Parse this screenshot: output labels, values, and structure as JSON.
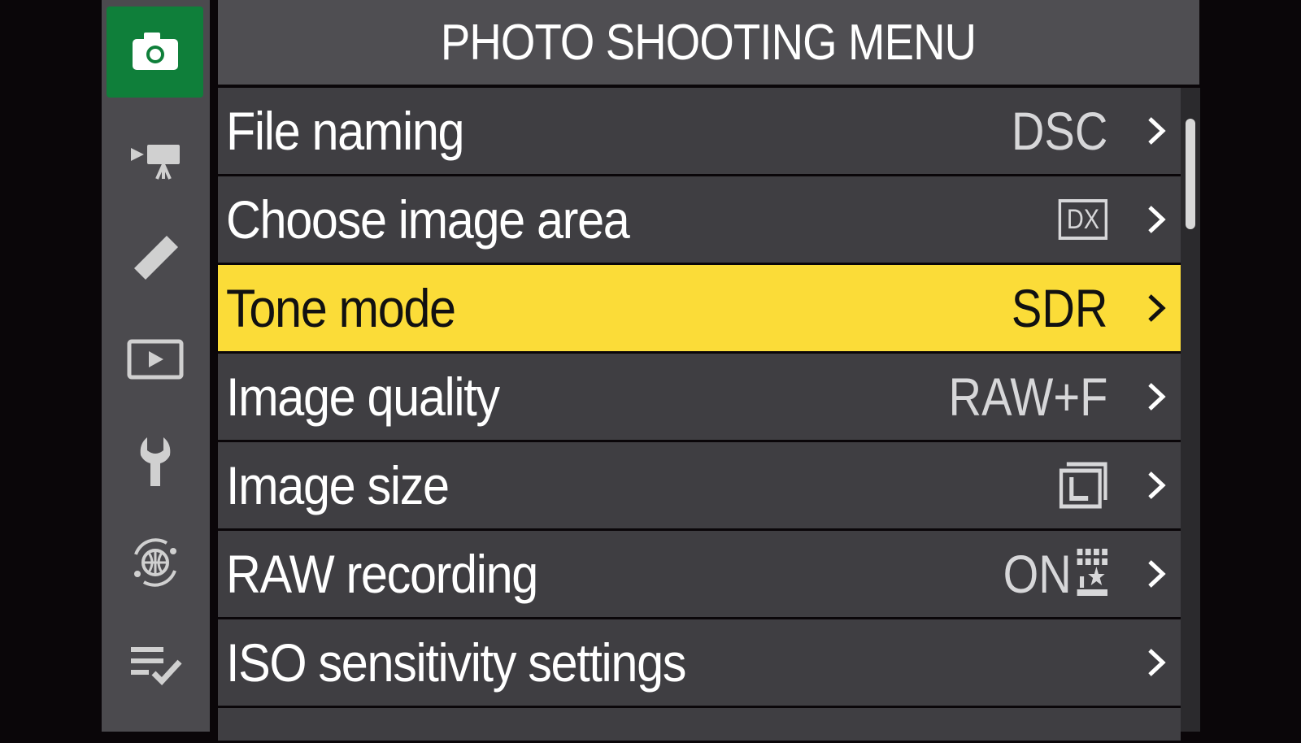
{
  "header": {
    "title": "PHOTO SHOOTING MENU"
  },
  "rail": {
    "items": [
      {
        "icon": "camera-icon",
        "active": true
      },
      {
        "icon": "movie-camera-icon",
        "active": false
      },
      {
        "icon": "pencil-icon",
        "active": false
      },
      {
        "icon": "playback-icon",
        "active": false
      },
      {
        "icon": "wrench-icon",
        "active": false
      },
      {
        "icon": "network-icon",
        "active": false
      },
      {
        "icon": "my-menu-icon",
        "active": false
      }
    ]
  },
  "menu": {
    "items": [
      {
        "label": "File naming",
        "value": "DSC",
        "value_type": "text"
      },
      {
        "label": "Choose image area",
        "value": "DX",
        "value_type": "boxed"
      },
      {
        "label": "Tone mode",
        "value": "SDR",
        "value_type": "text",
        "selected": true
      },
      {
        "label": "Image quality",
        "value": "RAW+F",
        "value_type": "text"
      },
      {
        "label": "Image size",
        "value": "",
        "value_type": "size-large-icon"
      },
      {
        "label": "RAW recording",
        "value": "ON",
        "value_type": "text+icon",
        "icon": "high-efficiency-star-icon"
      },
      {
        "label": "ISO sensitivity settings",
        "value": "",
        "value_type": "none"
      }
    ]
  },
  "colors": {
    "selected_bg": "#fbdc38",
    "active_tab_bg": "#0f7f3a",
    "row_bg": "#3f3e42"
  }
}
